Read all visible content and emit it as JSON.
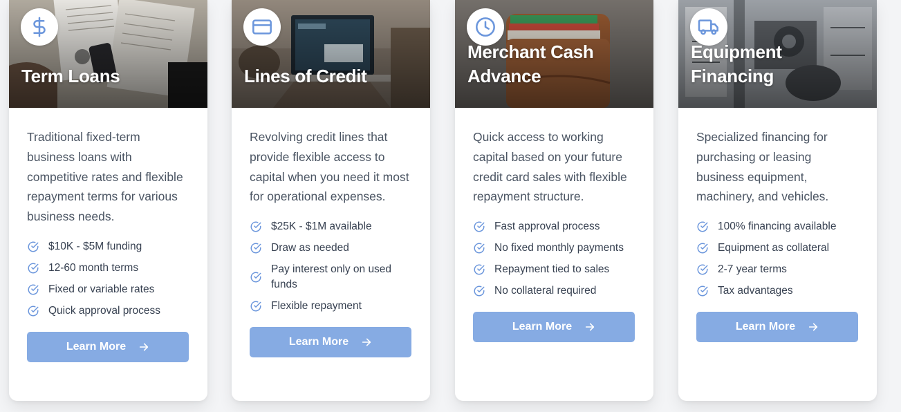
{
  "colors": {
    "accent": "#86abe3",
    "icon_blue": "#6b96dc",
    "text_body": "#4b5563",
    "text_feature": "#374151",
    "card_bg": "#ffffff",
    "page_bg": "#f3f4f6"
  },
  "cards": [
    {
      "icon": "dollar-icon",
      "title": "Term Loans",
      "description": "Traditional fixed-term business loans with competitive rates and flexible repayment terms for various business needs.",
      "features": [
        "$10K - $5M funding",
        "12-60 month terms",
        "Fixed or variable rates",
        "Quick approval process"
      ],
      "button_label": "Learn More"
    },
    {
      "icon": "credit-card-icon",
      "title": "Lines of Credit",
      "description": "Revolving credit lines that provide flexible access to capital when you need it most for operational expenses.",
      "features": [
        "$25K - $1M available",
        "Draw as needed",
        "Pay interest only on used funds",
        "Flexible repayment"
      ],
      "button_label": "Learn More"
    },
    {
      "icon": "clock-icon",
      "title": "Merchant Cash Advance",
      "description": "Quick access to working capital based on your future credit card sales with flexible repayment structure.",
      "features": [
        "Fast approval process",
        "No fixed monthly payments",
        "Repayment tied to sales",
        "No collateral required"
      ],
      "button_label": "Learn More"
    },
    {
      "icon": "truck-icon",
      "title": "Equipment Financing",
      "description": "Specialized financing for purchasing or leasing business equipment, machinery, and vehicles.",
      "features": [
        "100% financing available",
        "Equipment as collateral",
        "2-7 year terms",
        "Tax advantages"
      ],
      "button_label": "Learn More"
    }
  ]
}
